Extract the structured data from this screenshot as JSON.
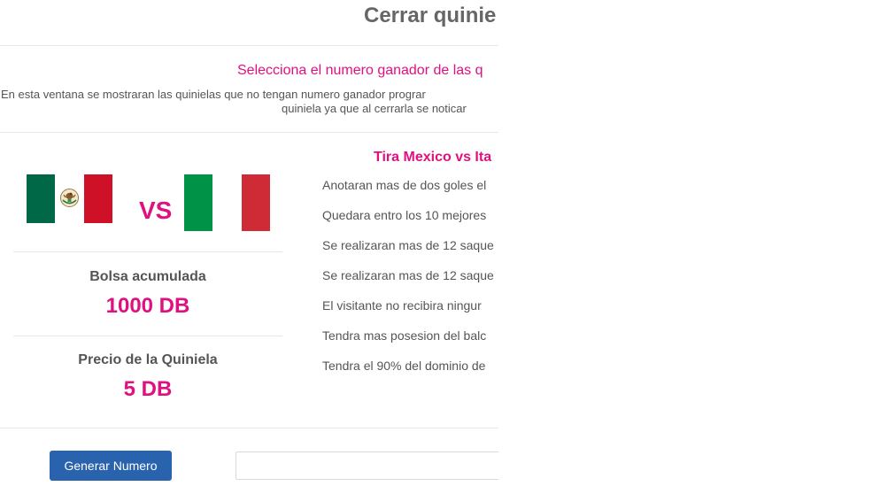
{
  "modal": {
    "title": "Cerrar quinie",
    "subtitle": "Selecciona el numero ganador de las q",
    "description_line1": "En esta ventana se mostraran las quinielas que no tengan numero ganador prograr",
    "description_line2": "quiniela ya que al cerrarla se noticar"
  },
  "match": {
    "home_flag": "mexico-flag",
    "away_flag": "italy-flag",
    "vs_label": "VS",
    "title": "Tira Mexico vs Ita",
    "questions": [
      "Anotaran mas de dos goles el",
      "Quedara entro los 10 mejores",
      "Se realizaran mas de 12 saque",
      "Se realizaran mas de 12 saque",
      "El visitante no recibira ningur",
      "Tendra mas posesion del balc",
      "Tendra el 90% del dominio de"
    ]
  },
  "stats": {
    "pot_label": "Bolsa acumulada",
    "pot_value": "1000 DB",
    "price_label": "Precio de la Quiniela",
    "price_value": "5 DB"
  },
  "actions": {
    "generate_label": "Generar Numero",
    "number_value": ""
  },
  "colors": {
    "accent": "#e0117f",
    "button": "#2a63ad",
    "text": "#555555"
  }
}
